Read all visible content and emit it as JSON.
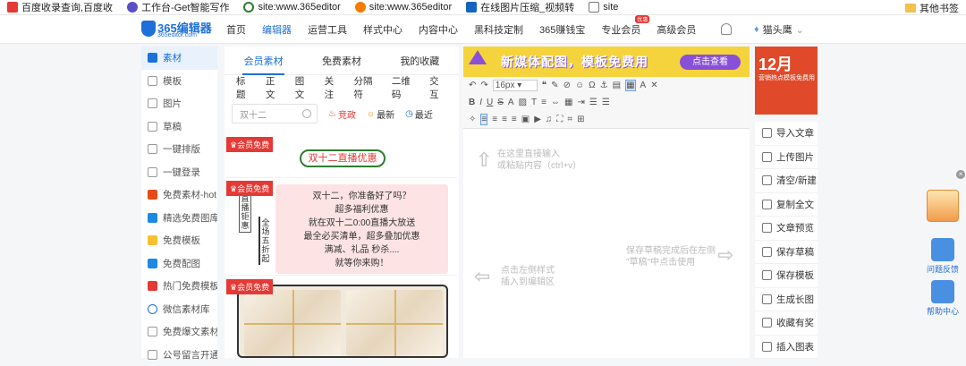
{
  "bookmarks": {
    "items": [
      {
        "label": "百度收录查询,百度收",
        "icon_color": "#e53935"
      },
      {
        "label": "工作台-Get智能写作",
        "icon_color": "#5b4fc7"
      },
      {
        "label": "site:www.365editor",
        "icon_color": "#2e7d32"
      },
      {
        "label": "site:www.365editor",
        "icon_color": "#f57c00"
      },
      {
        "label": "在线图片压缩_视频转",
        "icon_color": "#1565c0"
      },
      {
        "label": "site",
        "icon_color": "#777777"
      }
    ],
    "other_label": "其他书签"
  },
  "nav": {
    "logo_text": "365编辑器",
    "logo_sub": "365editor.com",
    "items": [
      "首页",
      "编辑器",
      "运营工具",
      "样式中心",
      "内容中心",
      "黑科技定制",
      "365赚钱宝",
      "专业会员",
      "高级会员"
    ],
    "vip_badge": "优惠",
    "username": "猫头鹰",
    "accent": "#1e6fd9"
  },
  "sidebar": {
    "items": [
      "素材",
      "模板",
      "图片",
      "草稿",
      "一键排版",
      "一键登录",
      "免费素材-hot",
      "精选免费图库",
      "免费模板",
      "免费配图",
      "热门免费模板",
      "微信素材库",
      "免费爆文素材",
      "公号留言开通"
    ]
  },
  "panel": {
    "tabs": [
      "会员素材",
      "免费素材",
      "我的收藏"
    ],
    "categories": [
      "标题",
      "正文",
      "图文",
      "关注",
      "分隔符",
      "二维码",
      "交互"
    ],
    "search": {
      "value": "双十二"
    },
    "filters": [
      "竞政",
      "最新",
      "最近"
    ],
    "vip_label": "会员免费",
    "card1": {
      "text": "双十二直播优惠"
    },
    "card2": {
      "vtext1": "直播钜惠",
      "vtext2": "全场五折起",
      "lines": [
        "双十二，你准备好了吗？",
        "超多福利优惠",
        "就在双十二0:00直播大放送",
        "最全必买清单，超多叠加优惠",
        "满减、礼品 秒杀....",
        "就等你来购！"
      ]
    }
  },
  "editor": {
    "banner_text": "新媒体配图，模板免费用",
    "banner_button": "点击查看",
    "font_size": "16px",
    "hint_top": [
      "在这里直接输入",
      "或粘贴内容（ctrl+v）"
    ],
    "hint_left": [
      "点击左侧样式",
      "插入到编辑区"
    ],
    "hint_right": [
      "保存草稿完成后在左侧",
      "\"草稿\"中点击使用"
    ]
  },
  "right": {
    "promo_big": "12月",
    "promo_small": "营销热点模板免费用",
    "actions": [
      "导入文章",
      "上传图片",
      "清空/新建",
      "复制全文",
      "文章预览",
      "保存草稿",
      "保存模板",
      "生成长图",
      "收藏有奖",
      "插入图表"
    ]
  },
  "floating": {
    "feedback": "问题反馈",
    "help": "帮助中心"
  }
}
